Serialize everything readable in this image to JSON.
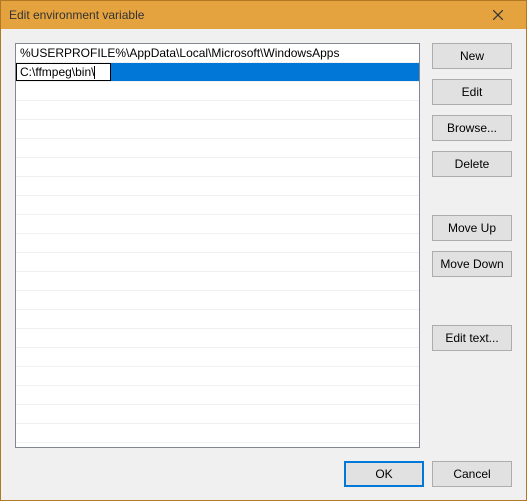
{
  "window": {
    "title": "Edit environment variable"
  },
  "list": {
    "items": [
      "%USERPROFILE%\\AppData\\Local\\Microsoft\\WindowsApps",
      "C:\\ffmpeg\\bin\\"
    ],
    "editing_index": 1
  },
  "buttons": {
    "new": "New",
    "edit": "Edit",
    "browse": "Browse...",
    "delete": "Delete",
    "move_up": "Move Up",
    "move_down": "Move Down",
    "edit_text": "Edit text...",
    "ok": "OK",
    "cancel": "Cancel"
  }
}
